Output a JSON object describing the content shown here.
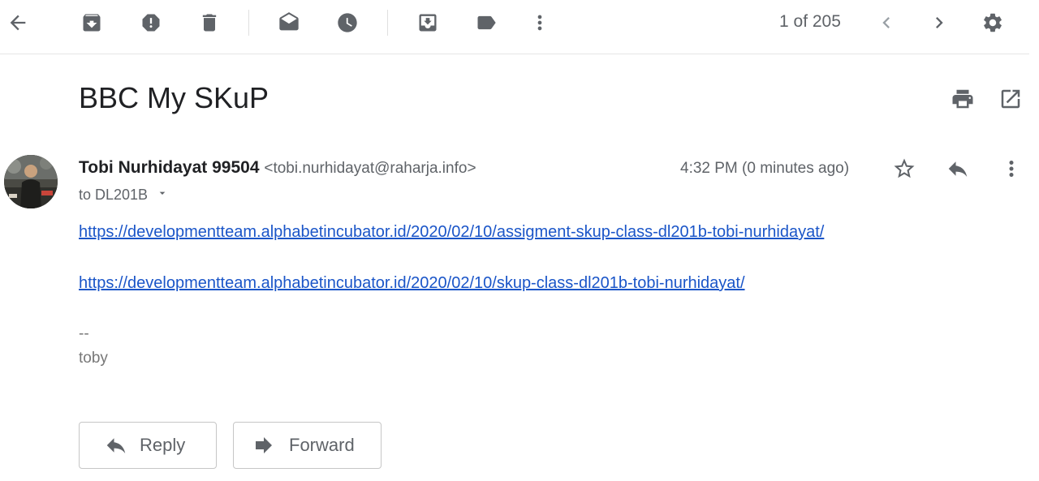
{
  "toolbar": {
    "pager_text": "1 of 205"
  },
  "message": {
    "subject": "BBC My SKuP",
    "sender_name": "Tobi Nurhidayat 99504",
    "sender_email": "<tobi.nurhidayat@raharja.info>",
    "recipient": "to DL201B",
    "timestamp": "4:32 PM (0 minutes ago)",
    "links": [
      "https://developmentteam.alphabetincubator.id/2020/02/10/assigment-skup-class-dl201b-tobi-nurhidayat/",
      "https://developmentteam.alphabetincubator.id/2020/02/10/skup-class-dl201b-tobi-nurhidayat/"
    ],
    "signature_separator": "--",
    "signature": "toby"
  },
  "actions": {
    "reply_label": "Reply",
    "forward_label": "Forward"
  },
  "icons": {
    "back": "arrow-left-icon",
    "archive": "archive-icon",
    "spam": "report-spam-icon",
    "delete": "trash-icon",
    "mark_unread": "mark-unread-icon",
    "snooze": "clock-icon",
    "move": "move-to-inbox-icon",
    "label": "label-icon",
    "more": "more-vert-icon",
    "prev": "chevron-left-icon",
    "next": "chevron-right-icon",
    "settings": "gear-icon",
    "print": "print-icon",
    "open_new": "open-in-new-icon",
    "star": "star-outline-icon",
    "reply": "reply-icon",
    "forward": "forward-icon"
  }
}
